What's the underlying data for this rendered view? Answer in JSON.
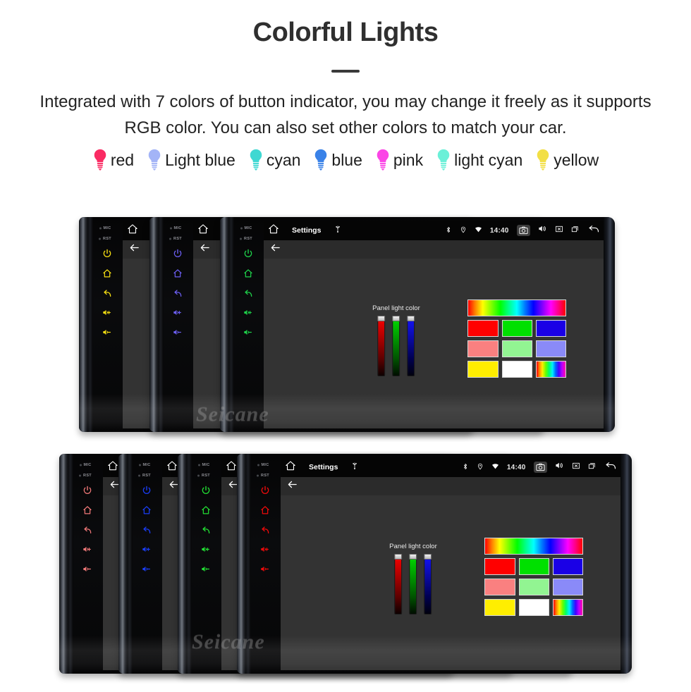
{
  "header": {
    "title": "Colorful Lights",
    "subtitle": "Integrated with 7 colors of button indicator, you may change it freely as it supports RGB color. You can also set other colors to match your car."
  },
  "legend": {
    "items": [
      {
        "label": "red",
        "color": "#fa2b63"
      },
      {
        "label": "Light blue",
        "color": "#a3b4f7"
      },
      {
        "label": "cyan",
        "color": "#3fd8d2"
      },
      {
        "label": "blue",
        "color": "#3a82e8"
      },
      {
        "label": "pink",
        "color": "#fb45e6"
      },
      {
        "label": "light cyan",
        "color": "#6bf0d8"
      },
      {
        "label": "yellow",
        "color": "#f2df45"
      }
    ]
  },
  "watermark": {
    "text": "Seicane"
  },
  "device_ui": {
    "side_panel": {
      "mic_label": "MIC",
      "rst_label": "RST",
      "buttons": [
        {
          "name": "power-icon"
        },
        {
          "name": "home-icon"
        },
        {
          "name": "back-icon"
        },
        {
          "name": "volume-up-icon"
        },
        {
          "name": "volume-down-icon"
        }
      ]
    },
    "status_bar": {
      "home_icon": "home-icon",
      "title": "Settings",
      "usb_icon": "usb-icon",
      "bluetooth_icon": "bluetooth-icon",
      "location_icon": "location-pin-icon",
      "wifi_icon": "wifi-icon",
      "time": "14:40",
      "camera_icon": "camera-icon",
      "volume_icon": "volume-icon",
      "close_icon": "close-box-icon",
      "recents_icon": "recent-apps-icon",
      "back_icon": "back-arrow-icon"
    },
    "action_bar": {
      "back_icon": "back-arrow-icon"
    },
    "panel": {
      "title": "Panel light color",
      "sliders": [
        {
          "name": "red-slider",
          "color": "#ff0000",
          "value": 100
        },
        {
          "name": "green-slider",
          "color": "#00e000",
          "value": 100
        },
        {
          "name": "blue-slider",
          "color": "#1414ff",
          "value": 100
        }
      ],
      "hue_bar": "hue-gradient-bar",
      "swatches": [
        [
          {
            "name": "swatch-red",
            "color": "#ff0000"
          },
          {
            "name": "swatch-green",
            "color": "#00e000"
          },
          {
            "name": "swatch-blue",
            "color": "#1a00e6"
          }
        ],
        [
          {
            "name": "swatch-light-red",
            "color": "#fa8080"
          },
          {
            "name": "swatch-light-green",
            "color": "#92f592"
          },
          {
            "name": "swatch-light-blue",
            "color": "#8a8af8"
          }
        ],
        [
          {
            "name": "swatch-yellow",
            "color": "#ffee00"
          },
          {
            "name": "swatch-white",
            "color": "#ffffff"
          },
          {
            "name": "swatch-rainbow",
            "color": "rainbow"
          }
        ]
      ]
    }
  },
  "stacks": [
    {
      "name": "stack-top",
      "units": [
        {
          "name": "unit-yellow",
          "button_color": "#f5dd12",
          "full": false
        },
        {
          "name": "unit-purple",
          "button_color": "#6b5ef0",
          "full": false
        },
        {
          "name": "unit-green",
          "button_color": "#1ed14a",
          "full": true
        }
      ]
    },
    {
      "name": "stack-bottom",
      "units": [
        {
          "name": "unit-salmon",
          "button_color": "#f07878",
          "full": false
        },
        {
          "name": "unit-blue",
          "button_color": "#1a3df5",
          "full": false
        },
        {
          "name": "unit-green",
          "button_color": "#22e033",
          "full": false
        },
        {
          "name": "unit-red",
          "button_color": "#f00a0a",
          "full": true
        }
      ]
    }
  ]
}
